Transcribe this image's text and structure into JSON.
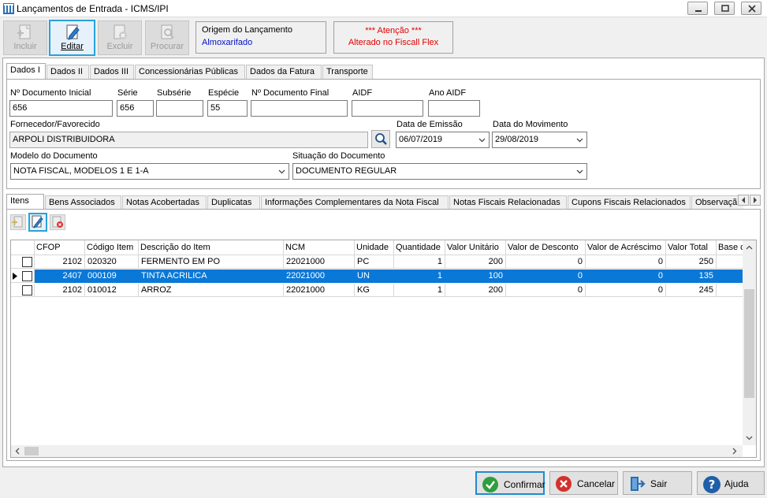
{
  "window": {
    "title": "Lançamentos de Entrada - ICMS/IPI"
  },
  "toolbar": {
    "incluir": "Incluir",
    "editar": "Editar",
    "excluir": "Excluir",
    "procurar": "Procurar"
  },
  "origem": {
    "label": "Origem do Lançamento",
    "value": "Almoxarifado"
  },
  "atencao": {
    "line1": "*** Atenção  ***",
    "line2": "Alterado no Fiscall Flex"
  },
  "tabs_top": [
    "Dados I",
    "Dados II",
    "Dados III",
    "Concessionárias Públicas",
    "Dados da Fatura",
    "Transporte"
  ],
  "form": {
    "doc_inicial_label": "Nº Documento Inicial",
    "doc_inicial": "656",
    "serie_label": "Série",
    "serie": "656",
    "subserie_label": "Subsérie",
    "subserie": "",
    "especie_label": "Espécie",
    "especie": "55",
    "doc_final_label": "Nº Documento Final",
    "doc_final": "",
    "aidf_label": "AIDF",
    "aidf": "",
    "ano_aidf_label": "Ano AIDF",
    "ano_aidf": "",
    "fornecedor_label": "Fornecedor/Favorecido",
    "fornecedor": "ARPOLI DISTRIBUIDORA",
    "data_emissao_label": "Data de Emissão",
    "data_emissao": "06/07/2019",
    "data_movimento_label": "Data do Movimento",
    "data_movimento": "29/08/2019",
    "modelo_label": "Modelo do Documento",
    "modelo": "NOTA FISCAL, MODELOS 1 E 1-A",
    "situacao_label": "Situação do Documento",
    "situacao": "DOCUMENTO REGULAR"
  },
  "tabs_bottom": [
    "Itens",
    "Bens Associados",
    "Notas Acobertadas",
    "Duplicatas",
    "Informações Complementares da Nota Fiscal",
    "Notas Fiscais Relacionadas",
    "Cupons Fiscais Relacionados",
    "Observaçã"
  ],
  "grid": {
    "headers": [
      "CFOP",
      "Código Item",
      "Descrição do Item",
      "NCM",
      "Unidade",
      "Quantidade",
      "Valor Unitário",
      "Valor de Desconto",
      "Valor de Acréscimo",
      "Valor Total",
      "Base d"
    ],
    "rows": [
      [
        "2102",
        "020320",
        "FERMENTO EM PO",
        "22021000",
        "PC",
        "1",
        "200",
        "0",
        "0",
        "250"
      ],
      [
        "2407",
        "000109",
        "TINTA ACRILICA",
        "22021000",
        "UN",
        "1",
        "100",
        "0",
        "0",
        "135"
      ],
      [
        "2102",
        "010012",
        "ARROZ",
        "22021000",
        "KG",
        "1",
        "200",
        "0",
        "0",
        "245"
      ]
    ],
    "selected_row": 1
  },
  "buttons": {
    "confirmar": "Confirmar",
    "cancelar": "Cancelar",
    "sair": "Sair",
    "ajuda": "Ajuda"
  },
  "colors": {
    "selection": "#0a78d7",
    "accent": "#27a2d9",
    "alert": "#e00000",
    "origem_value": "#0010c8"
  }
}
